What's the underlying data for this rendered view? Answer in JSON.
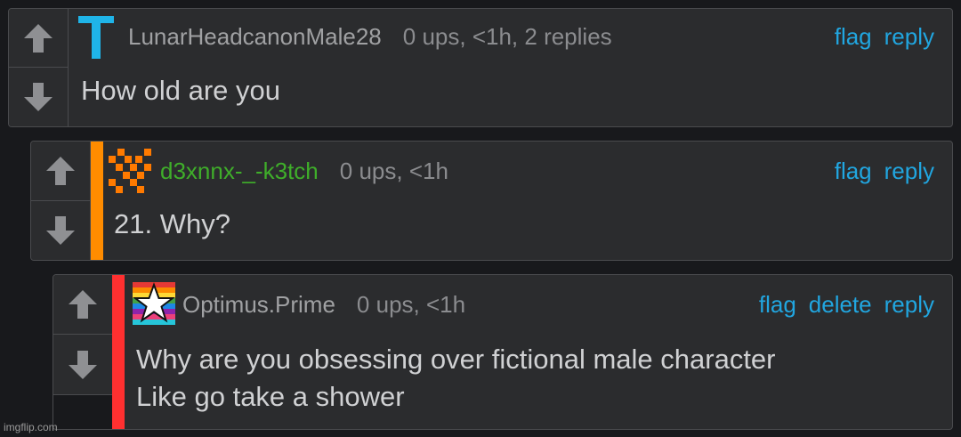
{
  "comments": [
    {
      "avatar_icon": "letter-t-avatar-icon",
      "avatar_letter": "T",
      "username": "LunarHeadcanonMale28",
      "meta": "0 ups, <1h, 2 replies",
      "actions": [
        "flag",
        "reply"
      ],
      "text_lines": [
        "How old are you"
      ],
      "username_color": "#a0a1a3"
    },
    {
      "avatar_icon": "pixel-pattern-avatar-icon",
      "stripe_color": "#ff8c00",
      "username": "d3xnnx-_-k3tch",
      "meta": "0 ups, <1h",
      "actions": [
        "flag",
        "reply"
      ],
      "text_lines": [
        "21. Why?"
      ],
      "username_color": "#3fae2a"
    },
    {
      "avatar_icon": "rainbow-star-avatar-icon",
      "stripe_color": "#ff3030",
      "username": "Optimus.Prime",
      "meta": "0 ups, <1h",
      "actions": [
        "flag",
        "delete",
        "reply"
      ],
      "text_lines": [
        "Why are you obsessing over fictional male character",
        "Like go take a shower"
      ],
      "username_color": "#a0a1a3"
    }
  ],
  "vote_icons": [
    "upvote-arrow-icon",
    "downvote-arrow-icon"
  ],
  "accent_color": "#21a6e0",
  "watermark": "imgflip.com"
}
